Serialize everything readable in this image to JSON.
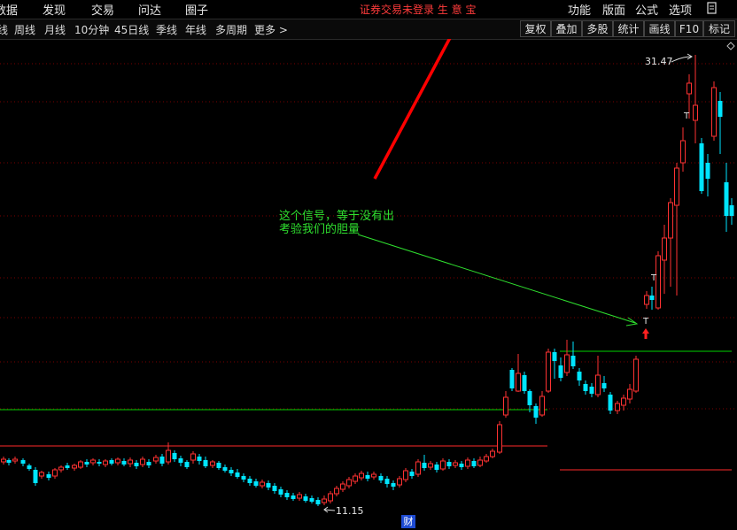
{
  "menu": {
    "left": [
      "数据",
      "发现",
      "交易",
      "问达",
      "圈子"
    ],
    "status_banner": "证券交易未登录  生 意 宝",
    "right": [
      "功能",
      "版面",
      "公式",
      "选项"
    ]
  },
  "toolbar": {
    "periods": [
      "线",
      "周线",
      "月线",
      "10分钟",
      "45日线",
      "季线",
      "年线",
      "多周期",
      "更多 >"
    ],
    "buttons": [
      "复权",
      "叠加",
      "多股",
      "统计",
      "画线",
      "F10",
      "标记"
    ]
  },
  "chart": {
    "high_label": "31.47",
    "low_label": "11.15",
    "signal_markers": [
      "T",
      "T",
      "T"
    ],
    "annotation": {
      "line1": "这个信号，等于没有出",
      "line2": "考验我们的胆量"
    },
    "footer_badge": "财",
    "colors": {
      "up": "#ff3232",
      "down": "#00e5ff",
      "hline_green": "#00d200",
      "hline_red": "#ff2a2a",
      "grid": "#7a0000",
      "annotation": "#2fe02f",
      "arrow_red": "#ff0000"
    }
  }
}
